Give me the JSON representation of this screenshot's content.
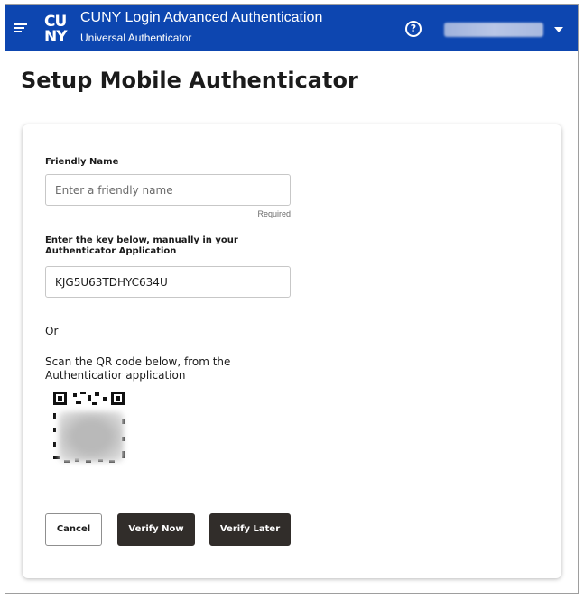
{
  "header": {
    "logo_text": "CUNY",
    "app_title": "CUNY Login Advanced Authentication",
    "app_subtitle": "Universal Authenticator",
    "help_glyph": "?",
    "accent_color": "#0d46b0",
    "icons": [
      "hamburger-icon",
      "help-icon",
      "chevron-down-icon"
    ]
  },
  "page": {
    "title": "Setup Mobile Authenticator"
  },
  "form": {
    "friendly_name": {
      "label": "Friendly Name",
      "placeholder": "Enter a friendly name",
      "value": "",
      "required_text": "Required"
    },
    "key": {
      "label": "Enter the key below, manually in your Authenticator Application",
      "value": "KJG5U63TDHYC634U"
    },
    "or_text": "Or",
    "scan_text": "Scan the QR code below, from the Authenticatior application"
  },
  "buttons": {
    "cancel": "Cancel",
    "verify_now": "Verify Now",
    "verify_later": "Verify Later",
    "primary_color": "#312d2a"
  }
}
